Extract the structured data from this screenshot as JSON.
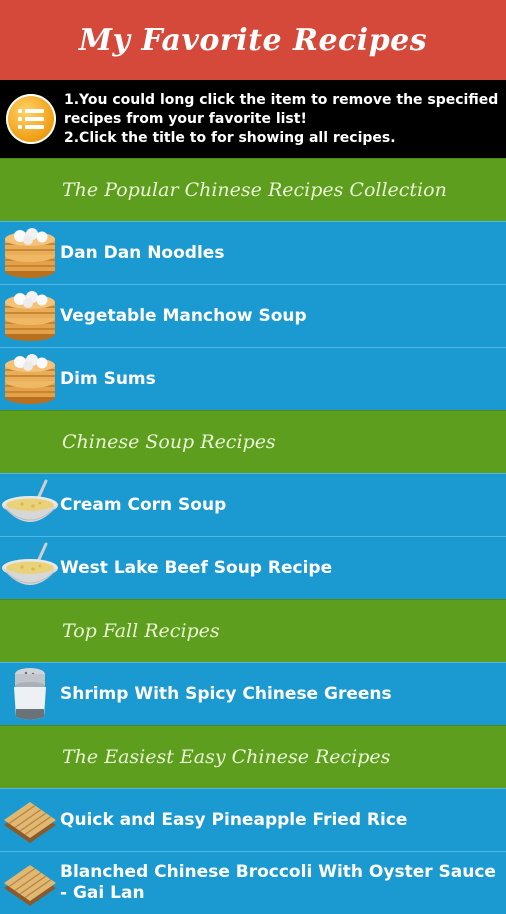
{
  "app": {
    "title": "My Favorite Recipes"
  },
  "info": {
    "icon": "list-icon",
    "line1": "1.You could long click the item to remove the specified recipes from your favorite list!",
    "line2": "2.Click the title to for showing all recipes."
  },
  "sections": [
    {
      "title": "The Popular Chinese Recipes Collection",
      "items": [
        {
          "label": "Dan Dan Noodles",
          "icon": "steamer-basket-icon"
        },
        {
          "label": "Vegetable Manchow Soup",
          "icon": "steamer-basket-icon"
        },
        {
          "label": "Dim Sums",
          "icon": "steamer-basket-icon"
        }
      ]
    },
    {
      "title": "Chinese Soup Recipes",
      "items": [
        {
          "label": "Cream Corn Soup",
          "icon": "soup-bowl-icon"
        },
        {
          "label": "West Lake Beef Soup Recipe",
          "icon": "soup-bowl-icon"
        }
      ]
    },
    {
      "title": "Top Fall Recipes",
      "items": [
        {
          "label": "Shrimp With Spicy Chinese Greens",
          "icon": "salt-shaker-icon"
        }
      ]
    },
    {
      "title": "The Easiest Easy Chinese Recipes",
      "items": [
        {
          "label": "Quick and Easy Pineapple Fried Rice",
          "icon": "bamboo-mat-icon"
        },
        {
          "label": "Blanched Chinese Broccoli With Oyster Sauce - Gai Lan",
          "icon": "bamboo-mat-icon"
        }
      ]
    }
  ]
}
